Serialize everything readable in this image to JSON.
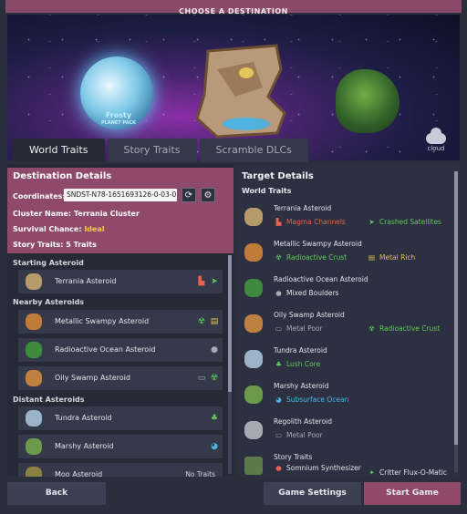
{
  "window": {
    "title": "CHOOSE A DESTINATION"
  },
  "hero": {
    "prev_label": "🡐",
    "next_label": "🡒",
    "planet_label_1": "Frosty",
    "planet_label_2": "PLANET PACK",
    "cloud_label": "cloud"
  },
  "tabs": [
    {
      "label": "World Traits",
      "active": true
    },
    {
      "label": "Story Traits",
      "active": false
    },
    {
      "label": "Scramble DLCs",
      "active": false
    }
  ],
  "destination": {
    "title": "Destination Details",
    "coordinates_label": "Coordinates:",
    "coordinates_value": "SNDST-N78-1651693126-0-03-0",
    "cluster": "Cluster Name: Terrania Cluster",
    "survival_label": "Survival Chance: ",
    "survival_value": "Ideal",
    "story_traits": "Story Traits: 5 Traits"
  },
  "asteroid_list": {
    "starting_header": "Starting Asteroid",
    "nearby_header": "Nearby Asteroids",
    "distant_header": "Distant Asteroids",
    "rows": [
      {
        "name": "Terrania Asteroid",
        "color": "#b59a6a"
      },
      {
        "name": "Metallic Swampy Asteroid",
        "color": "#c07a3a"
      },
      {
        "name": "Radioactive Ocean Asteroid",
        "color": "#3f8a3c"
      },
      {
        "name": "Oily Swamp Asteroid",
        "color": "#c08040"
      },
      {
        "name": "Tundra Asteroid",
        "color": "#9db3c8"
      },
      {
        "name": "Marshy Asteroid",
        "color": "#6a9a4a"
      },
      {
        "name": "Moo Asteroid",
        "color": "#8a8040",
        "note": "No Traits"
      }
    ]
  },
  "target": {
    "title": "Target Details",
    "world_traits_header": "World Traits",
    "story_traits_header": "Story Traits",
    "asteroids": [
      {
        "name": "Terrania Asteroid",
        "color": "#b59a6a",
        "traits": [
          "Magma Channels",
          "Crashed Satellites"
        ]
      },
      {
        "name": "Metallic Swampy Asteroid",
        "color": "#c07a3a",
        "traits": [
          "Radioactive Crust",
          "Metal Rich"
        ]
      },
      {
        "name": "Radioactive Ocean Asteroid",
        "color": "#3f8a3c",
        "traits": [
          "Mixed Boulders"
        ]
      },
      {
        "name": "Oily Swamp Asteroid",
        "color": "#c08040",
        "traits": [
          "Metal Poor",
          "Radioactive Crust"
        ]
      },
      {
        "name": "Tundra Asteroid",
        "color": "#9db3c8",
        "traits": [
          "Lush Core"
        ]
      },
      {
        "name": "Marshy Asteroid",
        "color": "#6a9a4a",
        "traits": [
          "Subsurface Ocean"
        ]
      },
      {
        "name": "Regolith Asteroid",
        "color": "#a8a8b0",
        "traits": [
          "Metal Poor"
        ]
      }
    ],
    "story_traits": [
      {
        "name": "Somnium Synthesizer"
      },
      {
        "name": "Critter Flux-O-Matic"
      }
    ]
  },
  "buttons": {
    "back": "Back",
    "settings": "Game Settings",
    "start": "Start Game"
  },
  "colors": {
    "accent": "#8f4a6b",
    "trait_red": "#e8604f",
    "trait_green": "#5fcb5a",
    "trait_gold": "#e7c04f",
    "trait_blue": "#4ab7e8",
    "ideal": "#f2c94c"
  }
}
